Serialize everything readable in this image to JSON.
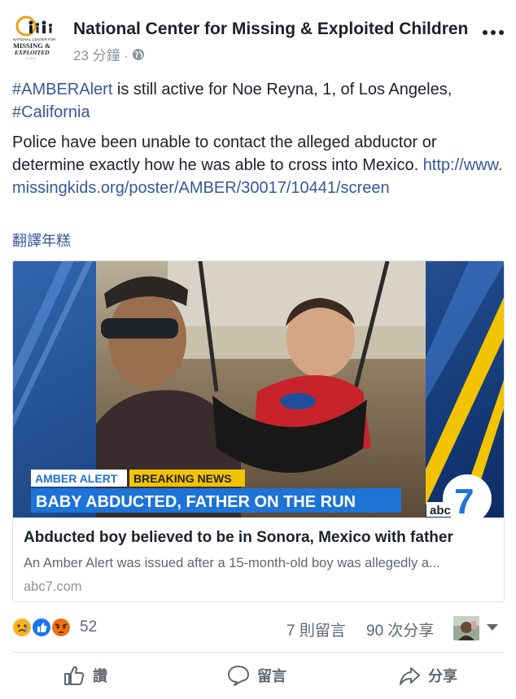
{
  "post": {
    "page_name": "National Center for Missing & Exploited Children",
    "time": "23 分鐘 ·",
    "logo_text": "MISSING & EXPLOITED",
    "paragraph1": {
      "hashtag1": "#AMBERAlert",
      "text": " is still active for Noe Reyna, 1, of Los Angeles, ",
      "hashtag2": "#California"
    },
    "paragraph2": {
      "text": "Police have been unable to contact the alleged abductor or determine exactly how he was able to cross into Mexico.",
      "link": "http://www.missingkids.org/poster/AMBER/30017/10441/screen"
    },
    "translate_label": "翻譯年糕"
  },
  "card": {
    "banner": {
      "tag1": "AMBER ALERT",
      "tag2": "BREAKING NEWS",
      "headline": "BABY ABDUCTED, FATHER ON THE RUN",
      "network": "abc"
    },
    "title": "Abducted boy believed to be in Sonora, Mexico with father",
    "description": "An Amber Alert was issued after a 15-month-old boy was allegedly a...",
    "domain": "abc7.com"
  },
  "reactions": {
    "count": "52",
    "comments": "7 則留言",
    "shares": "90 次分享"
  },
  "actions": {
    "like": "讚",
    "comment": "留言",
    "share": "分享"
  },
  "colors": {
    "link": "#365899",
    "banner_blue": "#1e73d6",
    "banner_yellow": "#f2c300"
  }
}
